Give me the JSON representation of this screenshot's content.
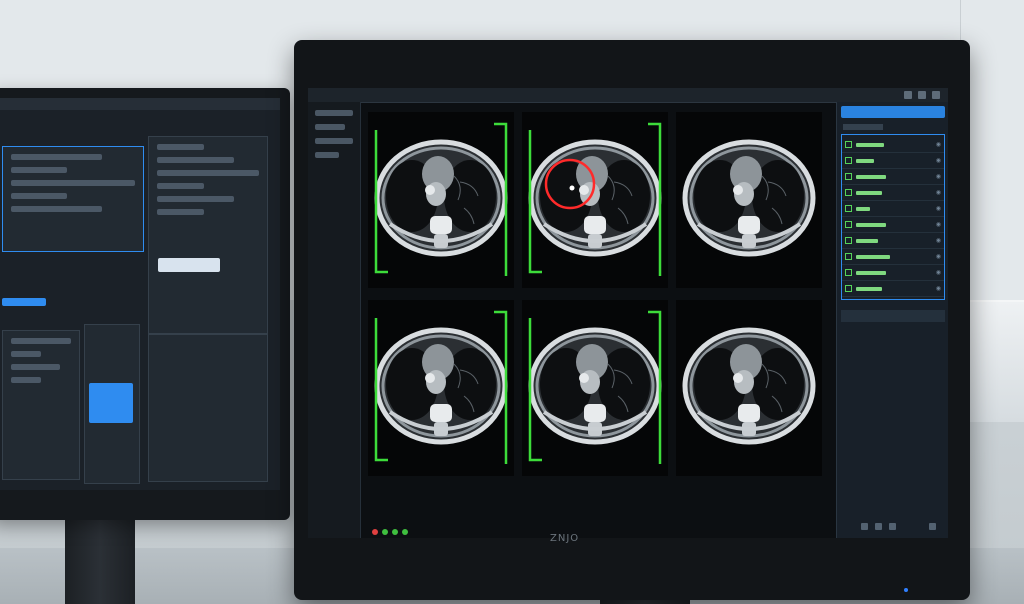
{
  "scene": {
    "brand_label": "ZNJO",
    "colors": {
      "wall": "#e3e8eb",
      "bezel": "#121518",
      "screen": "#0c0f12",
      "accent_blue": "#2f8cf0",
      "roi_green": "#3ddc3a",
      "lesion_red": "#ff2a2a"
    }
  },
  "left_monitor": {
    "window_tabs": [
      "",
      ""
    ],
    "buttons": [
      "",
      ""
    ]
  },
  "main_monitor": {
    "viewer": {
      "grid": "2x3",
      "slices": [
        {
          "roi": "green-bracket",
          "lesion": false
        },
        {
          "roi": "green-bracket",
          "lesion": true
        },
        {
          "roi": "none",
          "lesion": false
        },
        {
          "roi": "green-bracket",
          "lesion": false
        },
        {
          "roi": "green-bracket",
          "lesion": false
        },
        {
          "roi": "none",
          "lesion": false
        }
      ]
    },
    "right_panel": {
      "header_icon": "list-icon",
      "items": [
        {
          "icon": "checkbox-icon"
        },
        {
          "icon": "checkbox-icon"
        },
        {
          "icon": "checkbox-icon"
        },
        {
          "icon": "checkbox-icon"
        },
        {
          "icon": "checkbox-icon"
        },
        {
          "icon": "checkbox-icon"
        },
        {
          "icon": "checkbox-icon"
        },
        {
          "icon": "checkbox-icon"
        },
        {
          "icon": "checkbox-icon"
        },
        {
          "icon": "checkbox-icon"
        }
      ]
    },
    "status_colors": [
      "#e04040",
      "#3fbf3f",
      "#3fbf3f",
      "#3fbf3f"
    ]
  }
}
